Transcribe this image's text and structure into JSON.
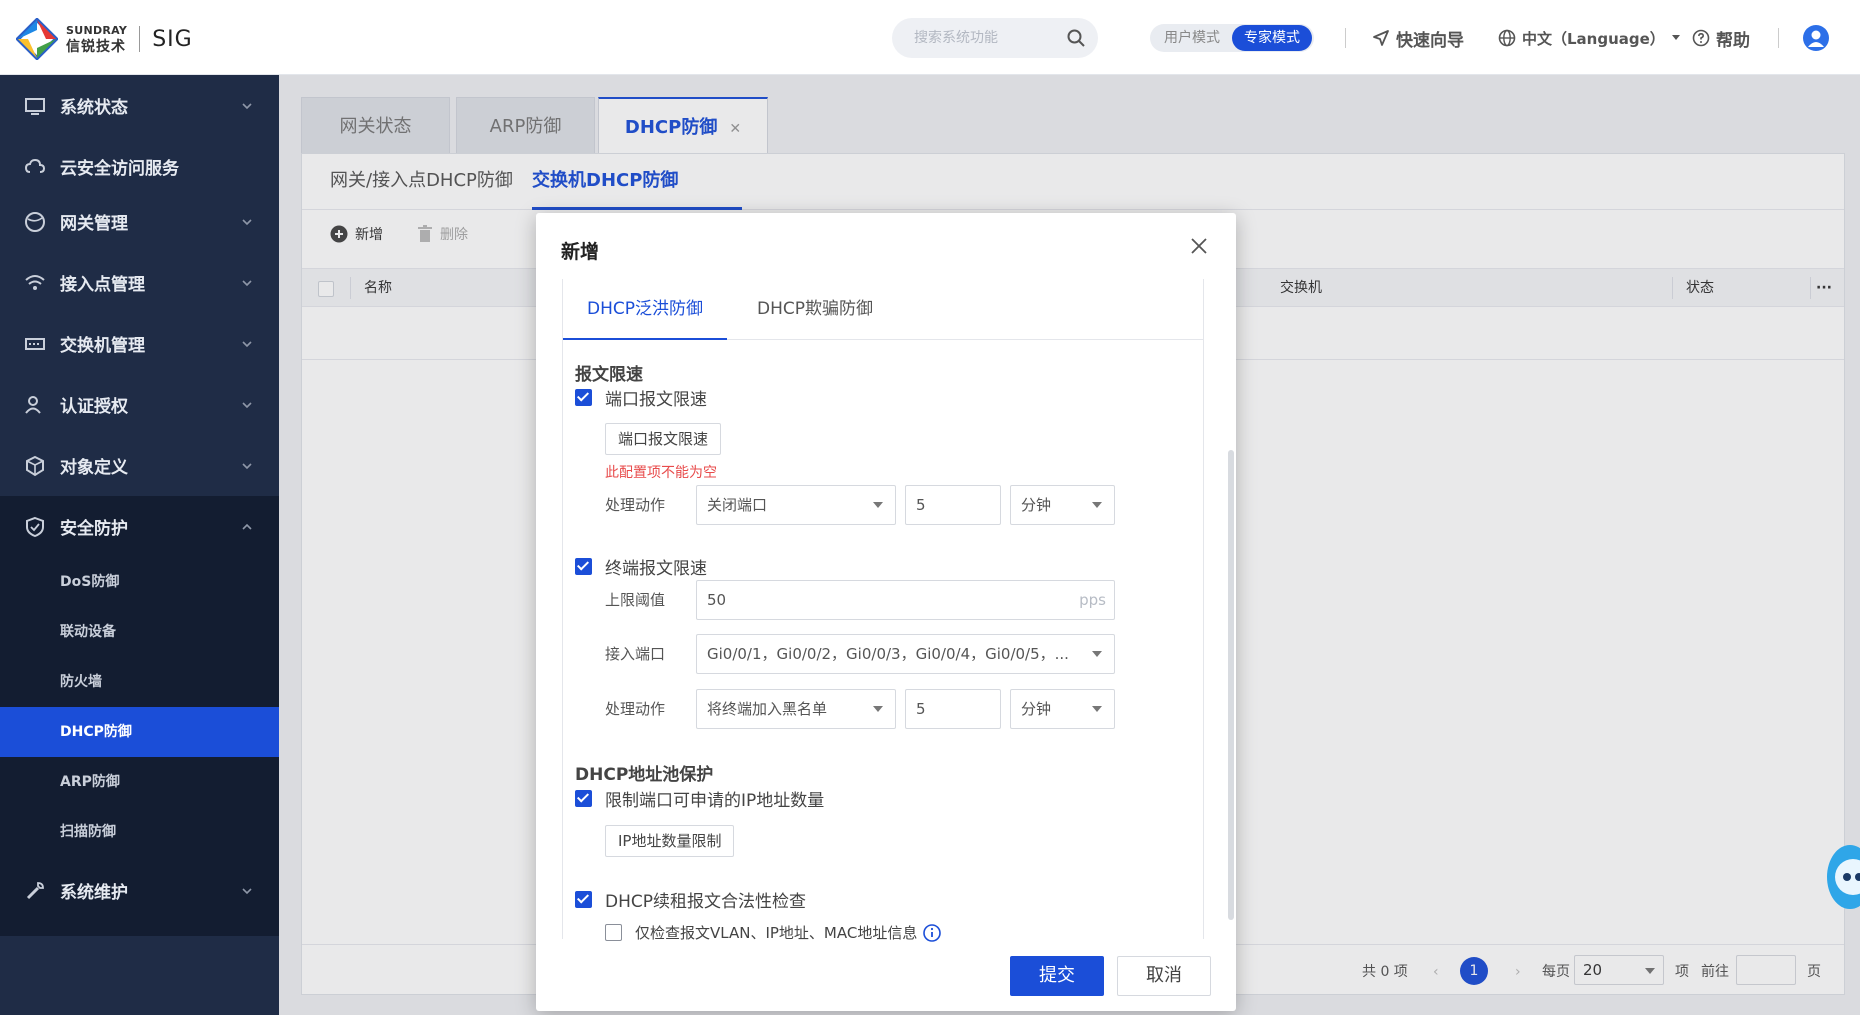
{
  "header": {
    "brand_en": "SUNDRAY",
    "brand_cn": "信锐技术",
    "product": "SIG",
    "search_placeholder": "搜索系统功能",
    "mode_user": "用户模式",
    "mode_expert": "专家模式",
    "quick_guide": "快速向导",
    "language": "中文（Language）",
    "help": "帮助"
  },
  "sidebar": {
    "items": [
      {
        "label": "系统状态"
      },
      {
        "label": "云安全访问服务"
      },
      {
        "label": "网关管理"
      },
      {
        "label": "接入点管理"
      },
      {
        "label": "交换机管理"
      },
      {
        "label": "认证授权"
      },
      {
        "label": "对象定义"
      },
      {
        "label": "安全防护"
      },
      {
        "label": "系统维护"
      }
    ],
    "security_sub": [
      {
        "label": "DoS防御"
      },
      {
        "label": "联动设备"
      },
      {
        "label": "防火墙"
      },
      {
        "label": "DHCP防御"
      },
      {
        "label": "ARP防御"
      },
      {
        "label": "扫描防御"
      }
    ]
  },
  "page_tabs": [
    {
      "label": "网关状态"
    },
    {
      "label": "ARP防御"
    },
    {
      "label": "DHCP防御"
    }
  ],
  "sub_tabs": [
    {
      "label": "网关/接入点DHCP防御"
    },
    {
      "label": "交换机DHCP防御"
    }
  ],
  "toolbar": {
    "add": "新增",
    "delete": "删除"
  },
  "table": {
    "headers": {
      "name": "名称",
      "switch": "交换机",
      "status": "状态",
      "more": "···"
    }
  },
  "pagination": {
    "total": "共 0 项",
    "current_page": "1",
    "per_page_label": "每页",
    "per_page": "20",
    "unit_item": "项",
    "goto_label": "前往",
    "unit_page": "页"
  },
  "modal": {
    "title": "新增",
    "tabs": [
      "DHCP泛洪防御",
      "DHCP欺骗防御"
    ],
    "section_rate": "报文限速",
    "port_rate_check": "端口报文限速",
    "port_rate_btn": "端口报文限速",
    "port_rate_error": "此配置项不能为空",
    "action_label": "处理动作",
    "port_action": "关闭端口",
    "port_action_value": "5",
    "port_action_unit": "分钟",
    "terminal_rate_check": "终端报文限速",
    "upper_limit_label": "上限阈值",
    "upper_limit_value": "50",
    "upper_limit_unit": "pps",
    "access_port_label": "接入端口",
    "access_port_value": "Gi0/0/1，Gi0/0/2，Gi0/0/3，Gi0/0/4，Gi0/0/5，...",
    "terminal_action": "将终端加入黑名单",
    "terminal_action_value": "5",
    "terminal_action_unit": "分钟",
    "section_pool": "DHCP地址池保护",
    "limit_ip_check": "限制端口可申请的IP地址数量",
    "ip_limit_btn": "IP地址数量限制",
    "renew_check": "DHCP续租报文合法性检查",
    "only_check": "仅检查报文VLAN、IP地址、MAC地址信息",
    "submit": "提交",
    "cancel": "取消"
  },
  "colors": {
    "primary": "#1b4ed8",
    "sidebar_bg": "#1f2c46",
    "sidebar_sub_bg": "#131d31",
    "error": "#e84c4c"
  }
}
